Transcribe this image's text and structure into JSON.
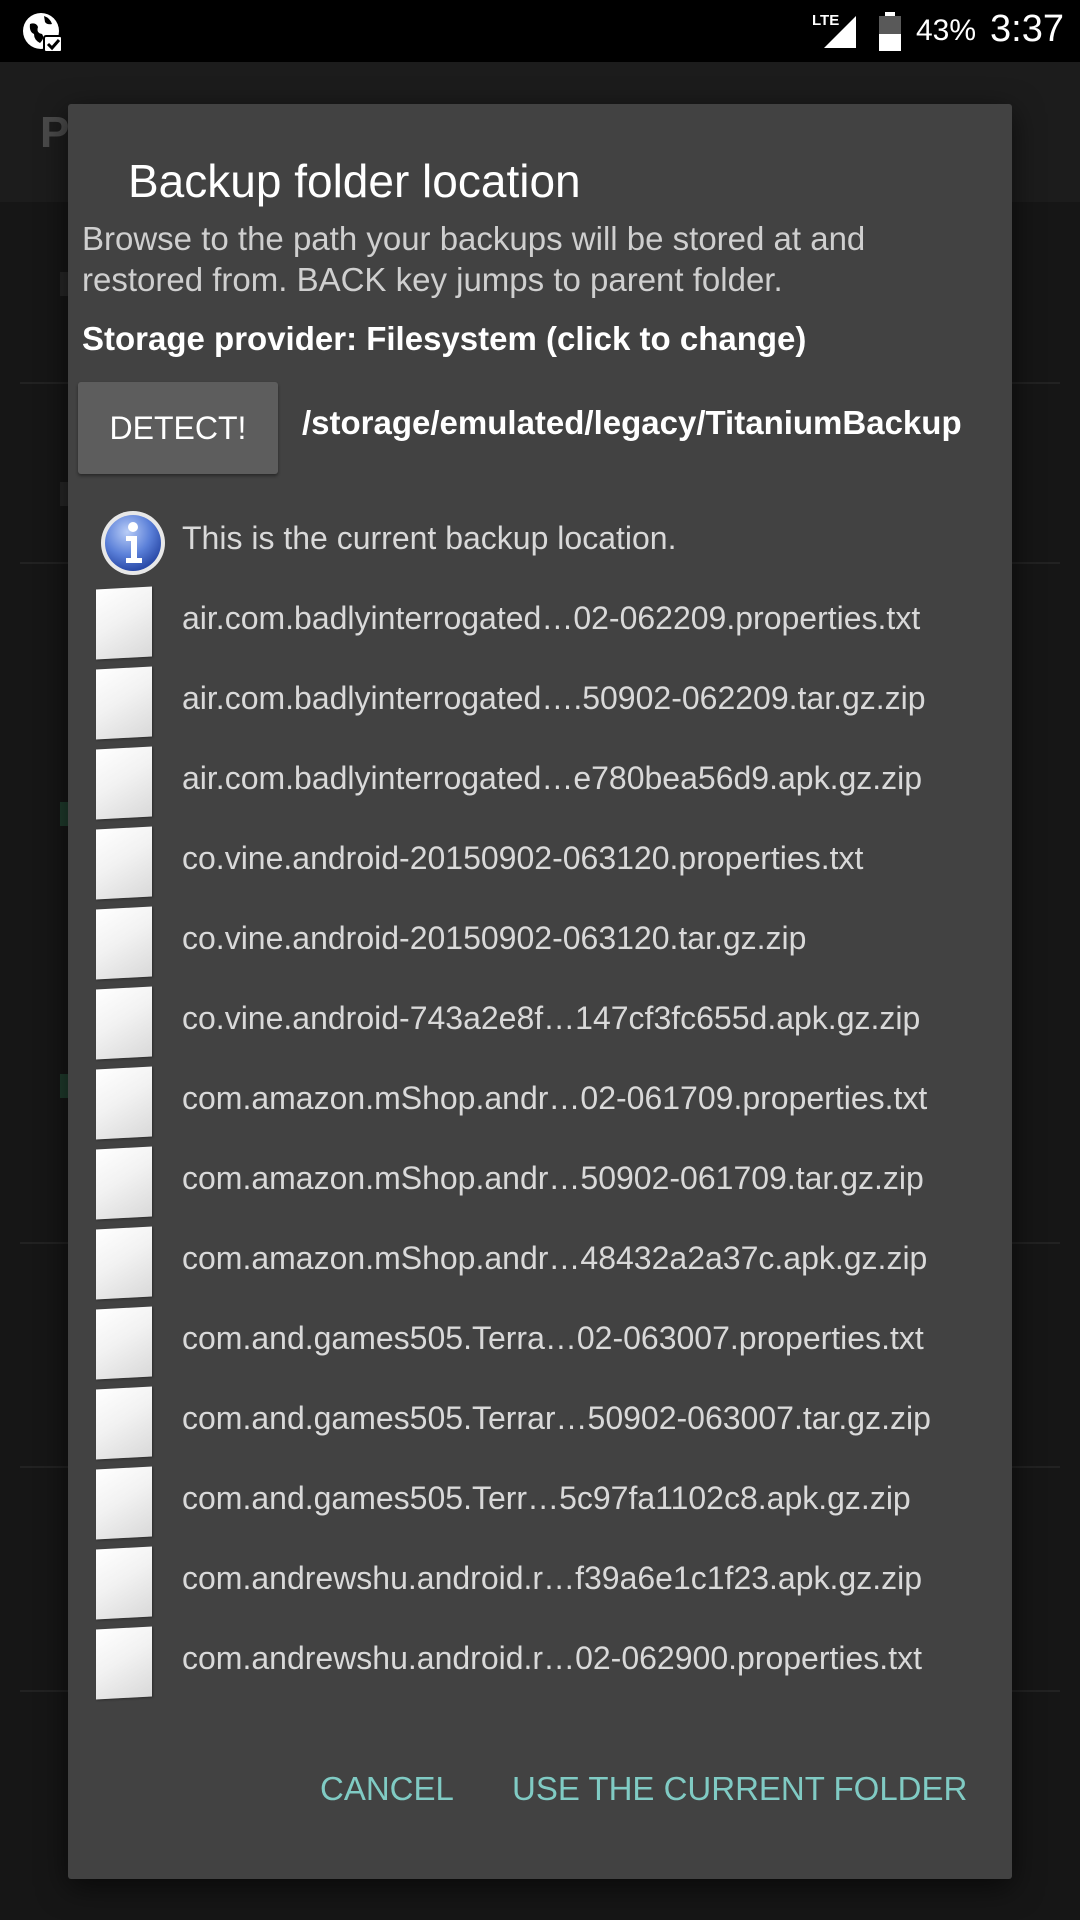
{
  "status_bar": {
    "network": "LTE",
    "battery_percent": "43%",
    "time": "3:37"
  },
  "background": {
    "title_fragment": "P"
  },
  "dialog": {
    "title": "Backup folder location",
    "description": "Browse to the path your backups will be stored at and restored from. BACK key jumps to parent folder.",
    "storage_provider": "Storage provider: Filesystem (click to change)",
    "detect_button": "DETECT!",
    "current_path": "/storage/emulated/legacy/TitaniumBackup",
    "info_text": "This is the current backup location.",
    "files": [
      "air.com.badlyinterrogated…02-062209.properties.txt",
      "air.com.badlyinterrogated….50902-062209.tar.gz.zip",
      "air.com.badlyinterrogated…e780bea56d9.apk.gz.zip",
      "co.vine.android-20150902-063120.properties.txt",
      "co.vine.android-20150902-063120.tar.gz.zip",
      "co.vine.android-743a2e8f…147cf3fc655d.apk.gz.zip",
      "com.amazon.mShop.andr…02-061709.properties.txt",
      "com.amazon.mShop.andr…50902-061709.tar.gz.zip",
      "com.amazon.mShop.andr…48432a2a37c.apk.gz.zip",
      "com.and.games505.Terra…02-063007.properties.txt",
      "com.and.games505.Terrar…50902-063007.tar.gz.zip",
      "com.and.games505.Terr…5c97fa1102c8.apk.gz.zip",
      "com.andrewshu.android.r…f39a6e1c1f23.apk.gz.zip",
      "com.andrewshu.android.r…02-062900.properties.txt"
    ],
    "cancel_button": "CANCEL",
    "use_folder_button": "USE THE CURRENT FOLDER"
  },
  "colors": {
    "dialog_bg": "#424242",
    "accent": "#80cbc4",
    "detect_button_bg": "#5d5d5d"
  }
}
